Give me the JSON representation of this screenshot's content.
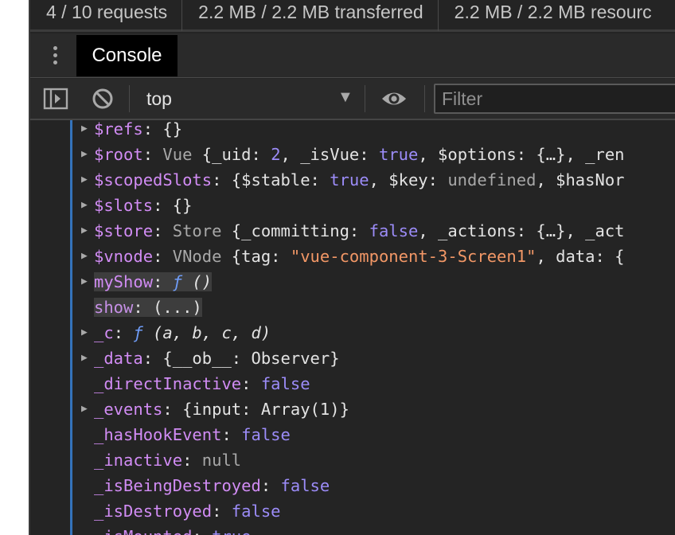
{
  "network_summary": {
    "requests": "4 / 10 requests",
    "transferred": "2.2 MB / 2.2 MB transferred",
    "resources": "2.2 MB / 2.2 MB resourc"
  },
  "drawer": {
    "menu_icon": "kebab-menu-icon",
    "tab_label": "Console"
  },
  "toolbar": {
    "sidebar_icon": "show-sidebar-icon",
    "clear_icon": "clear-console-icon",
    "context": "top",
    "context_dropdown_icon": "triangle-down-icon",
    "live_expression_icon": "eye-icon",
    "filter_placeholder": "Filter"
  },
  "rows": [
    {
      "key": "$refs",
      "punct": ": ",
      "rest": "{}"
    },
    {
      "key": "$root",
      "punct": ": ",
      "cls": "Vue",
      "a": " {_uid: ",
      "num": "2",
      "b": ", _isVue: ",
      "bool": "true",
      "c": ", $options: {…}, _ren"
    },
    {
      "key": "$scopedSlots",
      "punct": ": ",
      "a": "{$stable: ",
      "bool": "true",
      "b": ", $key: ",
      "undef": "undefined",
      "c": ", $hasNor"
    },
    {
      "key": "$slots",
      "punct": ": ",
      "rest": "{}"
    },
    {
      "key": "$store",
      "punct": ": ",
      "cls": "Store",
      "a": " {_committing: ",
      "bool": "false",
      "b": ", _actions: {…}, _act"
    },
    {
      "key": "$vnode",
      "punct": ": ",
      "cls": "VNode",
      "a": " {tag: ",
      "str": "\"vue-component-3-Screen1\"",
      "b": ", data: {"
    },
    {
      "key": "myShow",
      "punct": ": ",
      "fn": "ƒ",
      "args": " ()"
    },
    {
      "key": "show",
      "punct": ": ",
      "rest": "(...)"
    },
    {
      "key": "_c",
      "punct": ": ",
      "fn": "ƒ",
      "args": " (a, b, c, d)"
    },
    {
      "key": "_data",
      "punct": ": ",
      "rest": "{__ob__: Observer}"
    },
    {
      "key": "_directInactive",
      "punct": ": ",
      "bool": "false"
    },
    {
      "key": "_events",
      "punct": ": ",
      "a": "{input: ",
      "b": "Array(1)}"
    },
    {
      "key": "_hasHookEvent",
      "punct": ": ",
      "bool": "false"
    },
    {
      "key": "_inactive",
      "punct": ": ",
      "nul": "null"
    },
    {
      "key": "_isBeingDestroyed",
      "punct": ": ",
      "bool": "false"
    },
    {
      "key": "_isDestroyed",
      "punct": ": ",
      "bool": "false"
    },
    {
      "key": "_isMounted",
      "punct": ": ",
      "bool": "true"
    }
  ]
}
